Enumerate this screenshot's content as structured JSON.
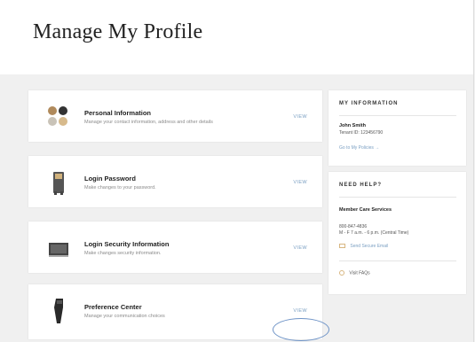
{
  "header": {
    "title": "Manage My Profile"
  },
  "cards": [
    {
      "title": "Personal Information",
      "desc": "Manage your contact information, address and other details",
      "action": "VIEW"
    },
    {
      "title": "Login Password",
      "desc": "Make changes to your password.",
      "action": "VIEW"
    },
    {
      "title": "Login Security Information",
      "desc": "Make changes security information.",
      "action": "VIEW"
    },
    {
      "title": "Preference Center",
      "desc": "Manage your communication choices",
      "action": "VIEW"
    }
  ],
  "my_information": {
    "title": "MY INFORMATION",
    "name": "John Smith",
    "tenant_id": "Tenant ID: 123456790",
    "link": "Go to My Policies →"
  },
  "need_help": {
    "title": "NEED HELP?",
    "service_title": "Member Care Services",
    "phone": "800-847-4836",
    "hours": "M - F 7 a.m. - 6 p.m. (Central Time)",
    "email_link": "Send Secure Email",
    "faq_link": "Visit FAQs"
  },
  "colors": {
    "link": "#7a9fc2",
    "background": "#f0f0f0",
    "annotation": "#6f94c7"
  }
}
